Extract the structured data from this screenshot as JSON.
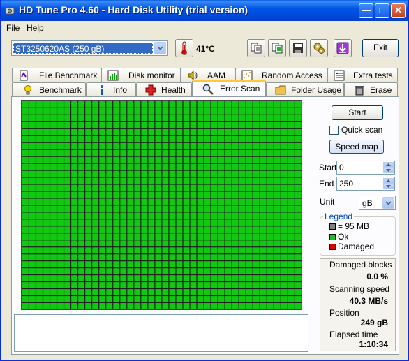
{
  "window": {
    "title": "HD Tune Pro 4.60 - Hard Disk Utility (trial version)"
  },
  "menu": {
    "file": "File",
    "help": "Help"
  },
  "toolbar": {
    "drive": "ST3250620AS (250 gB)",
    "temperature": "41°C",
    "exit_label": "Exit"
  },
  "tabs_top": [
    {
      "label": "File Benchmark",
      "icon": "file-benchmark-icon"
    },
    {
      "label": "Disk monitor",
      "icon": "disk-monitor-icon"
    },
    {
      "label": "AAM",
      "icon": "speaker-icon"
    },
    {
      "label": "Random Access",
      "icon": "random-access-icon"
    },
    {
      "label": "Extra tests",
      "icon": "extra-tests-icon"
    }
  ],
  "tabs_bottom": [
    {
      "label": "Benchmark",
      "icon": "benchmark-bulb-icon"
    },
    {
      "label": "Info",
      "icon": "info-icon"
    },
    {
      "label": "Health",
      "icon": "health-cross-icon"
    },
    {
      "label": "Error Scan",
      "icon": "magnifier-icon",
      "active": true
    },
    {
      "label": "Folder Usage",
      "icon": "folder-icon"
    },
    {
      "label": "Erase",
      "icon": "trash-icon"
    }
  ],
  "scan": {
    "grid_cols": 40,
    "grid_rows": 30,
    "ok_blocks_fraction": 1.0,
    "ok_color": "#12c912",
    "damaged_color": "#e00000",
    "unscanned_color": "#808080"
  },
  "controls": {
    "start_label": "Start",
    "quick_scan_label": "Quick scan",
    "quick_scan_checked": false,
    "speed_map_label": "Speed map",
    "start_field_label": "Start",
    "start_value": "0",
    "end_field_label": "End",
    "end_value": "250",
    "unit_label": "Unit",
    "unit_value": "gB"
  },
  "legend": {
    "title": "Legend",
    "block_size": "= 95 MB",
    "ok": "Ok",
    "damaged": "Damaged"
  },
  "stats": {
    "damaged_blocks_label": "Damaged blocks",
    "damaged_blocks_value": "0.0 %",
    "scanning_speed_label": "Scanning speed",
    "scanning_speed_value": "40.3 MB/s",
    "position_label": "Position",
    "position_value": "249 gB",
    "elapsed_label": "Elapsed time",
    "elapsed_value": "1:10:34"
  }
}
